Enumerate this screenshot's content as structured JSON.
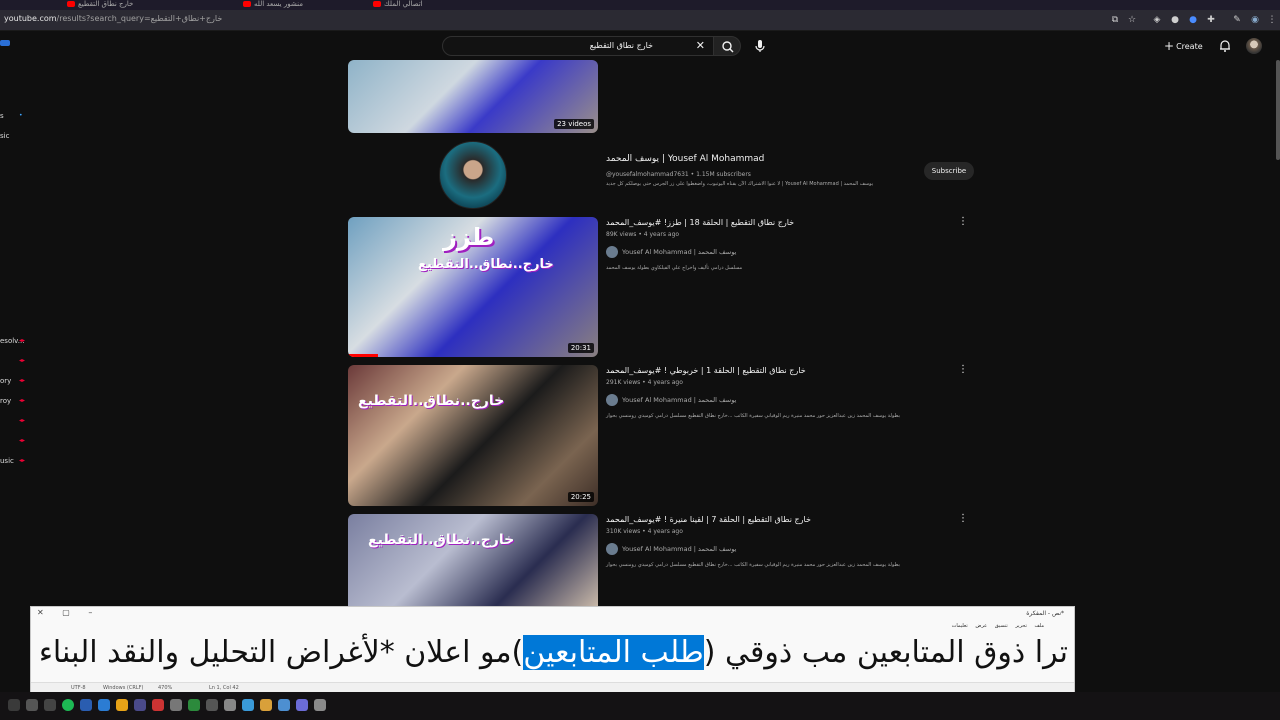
{
  "browser": {
    "url_host": "youtube.com",
    "url_path": "/results?search_query=خارج+نطاق+التقطيع",
    "tabs": [
      {
        "label": "خارج نطاق التقطيع"
      },
      {
        "label": "منشور يسعد الله"
      },
      {
        "label": "اتصالي الملك"
      }
    ]
  },
  "youtube": {
    "search": {
      "value": "خارج نطاق التقطيع"
    },
    "create_label": "Create",
    "sidebar_fragments": [
      {
        "label": "s"
      },
      {
        "label": "sic"
      },
      {
        "label": "esolv..."
      },
      {
        "label": "ory"
      },
      {
        "label": "roy"
      },
      {
        "label": "usic"
      }
    ],
    "playlist": {
      "badge": "23 videos"
    },
    "channel": {
      "name": "يوسف المحمد | Yousef Al Mohammad",
      "handle_subs": "@yousefalmohammad7631 • 1.15M subscribers",
      "description": "لا عنوا الاشتراك الآن بقناه اليوتيوب، واضغطوا على زر الجرس حتى يوصلكم كل جديد | Yousef Al Mohammad | يوسف المحمد",
      "subscribe_label": "Subscribe"
    },
    "videos": [
      {
        "title": "خارج نطاق التقطيع | الحلقة 18 | طزز! #يوسف_المحمد",
        "meta": "89K views • 4 years ago",
        "channel": "Yousef Al Mohammad | يوسف المحمد",
        "description": "مسلسل درامي تأليف واخراج علي الفيلكاوي بطولة يوسف المحمد",
        "duration": "20:31",
        "thumb_text": [
          "طزز",
          "خارج..نطاق..التقطيع"
        ]
      },
      {
        "title": "خارج نطاق التقطيع | الحلقة 1 | خربوطي ! #يوسف_المحمد",
        "meta": "291K views • 4 years ago",
        "channel": "Yousef Al Mohammad | يوسف المحمد",
        "description": "بطولة يوسف المحمد زين عبدالعزيز حور محمد منيرة ريم الوقياني سفيرة الكاتب ...خارج نطاق التقطيع مسلسل درامي كوميدي رومنسي بحوار",
        "duration": "20:25",
        "thumb_text": [
          "خارج..نطاق..التقطيع"
        ]
      },
      {
        "title": "خارج نطاق التقطيع | الحلقة 7 | لقينا منيرة ! #يوسف_المحمد",
        "meta": "310K views • 4 years ago",
        "channel": "Yousef Al Mohammad | يوسف المحمد",
        "description": "بطولة يوسف المحمد زين عبدالعزيز حور محمد منيرة ريم الوقياني سفيرة الكاتب ...خارج نطاق التقطيع مسلسل درامي كوميدي رومنسي بحوار",
        "duration": "",
        "thumb_text": [
          "خارج..نطاق..التقطيع"
        ]
      }
    ]
  },
  "notepad": {
    "title": "*نص - المفكرة",
    "menu": [
      "ملف",
      "تحرير",
      "تنسيق",
      "عرض",
      "تعليمات"
    ],
    "text_before": "ترا ذوق المتابعين مب ذوقي (",
    "text_selected": "طلب المتابعين",
    "text_after": ")مو اعلان *لأغراض التحليل والنقد البناء",
    "status": {
      "encoding": "UTF-8",
      "line_ending": "Windows (CRLF)",
      "zoom": "470%",
      "position": "Ln 1, Col 42"
    }
  },
  "colors": {
    "yt_bg": "#0f0f0f",
    "yt_red": "#ff0000",
    "selection": "#0078d7"
  }
}
